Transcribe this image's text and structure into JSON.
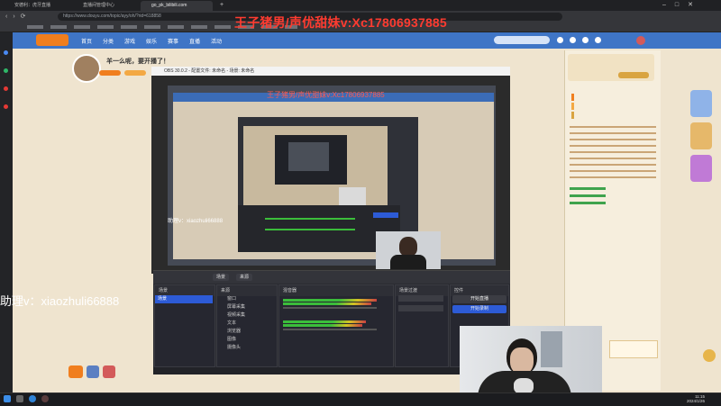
{
  "browser": {
    "tabs": [
      {
        "label": "安德利：虎牙直播"
      },
      {
        "label": "直播间管理中心"
      },
      {
        "label": "go_pk_bilibili.com"
      }
    ],
    "url": "https://www.douyu.com/topic/ayy/oh/?rid=618858"
  },
  "overlay": {
    "watermark": "王子猪男/声优甜妹v:Xc17806937885",
    "assistant": "助理v：xiaozhuli66888",
    "nested_watermark": "王子猪男/声优甜妹v:Xc17806937885",
    "nested_assistant": "助理v：xiaozhuli66888"
  },
  "site": {
    "nav_items": [
      "首页",
      "分类",
      "游戏",
      "娱乐",
      "赛事",
      "直播",
      "活动"
    ],
    "room_title": "羊一么呢，要开播了！"
  },
  "player": {
    "title_text": "OBS 30.0.2 - 配置文件: 未命名 - 场景: 未命名"
  },
  "obs": {
    "topbar_buttons": [
      "场景",
      "来源"
    ],
    "docks": [
      {
        "title": "场景"
      },
      {
        "title": "来源"
      },
      {
        "title": "混音器"
      },
      {
        "title": "场景过渡"
      },
      {
        "title": "控件"
      }
    ],
    "selected_scene": "场景",
    "sources": [
      "窗口",
      "屏幕采集",
      "视频采集",
      "文本",
      "浏览器",
      "图像",
      "摄像头"
    ],
    "controls": [
      "开始直播",
      "开始录制"
    ]
  },
  "taskbar": {
    "time": "11:15",
    "date": "2024/1/26"
  },
  "colors": {
    "site_nav": "#3f75c6",
    "site_bg": "#efe4cf",
    "watermark": "#ff3b30",
    "obs_bg": "#2a2b31",
    "obs_accent": "#2d5bd6"
  }
}
